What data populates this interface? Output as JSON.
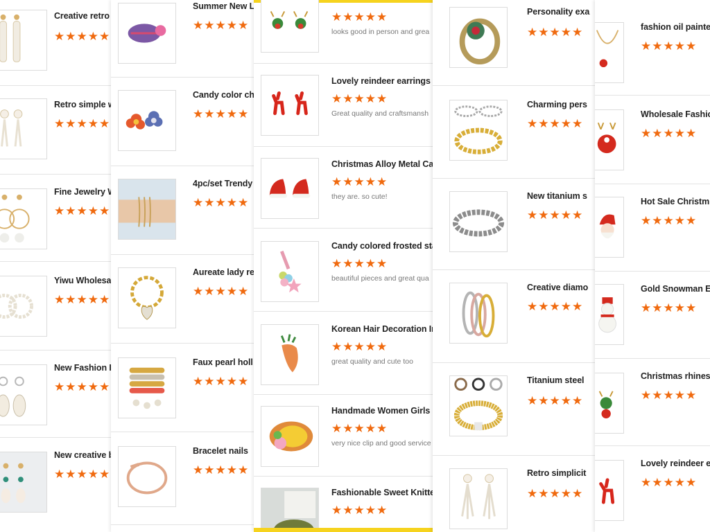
{
  "colors": {
    "star": "#f06a0f",
    "accent_bar": "#f6d31e",
    "border": "#dcdcdc"
  },
  "panels": [
    {
      "items": [
        {
          "title": "Creative retro",
          "stars": "★★★★★",
          "icon": "pearl-drop-earrings-icon"
        },
        {
          "title": "Retro simple w",
          "stars": "★★★★★",
          "icon": "pearl-tassel-earrings-icon"
        },
        {
          "title": "Fine Jewelry W",
          "stars": "★★★★★",
          "icon": "pearl-hoop-earrings-icon"
        },
        {
          "title": "Yiwu Wholesa",
          "stars": "★★★★★",
          "icon": "pearl-ring-earrings-icon"
        },
        {
          "title": "New Fashion E",
          "stars": "★★★★★",
          "icon": "shell-earrings-icon"
        },
        {
          "title": "New creative b",
          "stars": "★★★★★",
          "icon": "bead-drop-earrings-icon"
        }
      ]
    },
    {
      "items": [
        {
          "title": "Summer New L",
          "stars": "★★★★★",
          "icon": "knitted-hair-clip-icon"
        },
        {
          "title": "Candy color ch",
          "stars": "★★★★★",
          "icon": "flower-hair-clips-icon"
        },
        {
          "title": "4pc/set Trendy",
          "stars": "★★★★★",
          "icon": "bracelet-set-on-wrist-icon"
        },
        {
          "title": "Aureate lady re",
          "stars": "★★★★★",
          "icon": "gold-heart-chain-bracelet-icon"
        },
        {
          "title": "Faux pearl holl",
          "stars": "★★★★★",
          "icon": "bangle-stack-icon"
        },
        {
          "title": "Bracelet nails",
          "stars": "★★★★★",
          "icon": "nail-bangle-icon"
        }
      ]
    },
    {
      "items": [
        {
          "title": "",
          "stars": "★★★★★",
          "review": "looks good in person and grea",
          "icon": "reindeer-stud-earrings-icon"
        },
        {
          "title": "Lovely reindeer earrings fo",
          "stars": "★★★★★",
          "review": "Great quality and craftsmansh",
          "icon": "red-reindeer-earrings-icon"
        },
        {
          "title": "Christmas Alloy Metal Car",
          "stars": "★★★★★",
          "review": "they are. so cute!",
          "icon": "santa-hat-earrings-icon"
        },
        {
          "title": "Candy colored frosted star",
          "stars": "★★★★★",
          "review": "beautiful pieces and great qua",
          "icon": "star-hair-clip-icon"
        },
        {
          "title": "Korean Hair Decoration Im",
          "stars": "★★★★★",
          "review": "great quality and cute too",
          "icon": "carrot-hair-clip-icon"
        },
        {
          "title": "Handmade Women Girls S",
          "stars": "★★★★★",
          "review": "very nice clip and good service",
          "icon": "pineapple-hair-clip-icon"
        },
        {
          "title": "Fashionable Sweet Knitted",
          "stars": "★★★★★",
          "review": "",
          "icon": "knitted-headband-icon"
        }
      ]
    },
    {
      "items": [
        {
          "title": "Personality exa",
          "stars": "★★★★★",
          "icon": "jeweled-cuff-bracelet-icon"
        },
        {
          "title": "Charming pers",
          "stars": "★★★★★",
          "icon": "gold-silver-chain-bracelets-icon"
        },
        {
          "title": "New titanium s",
          "stars": "★★★★★",
          "icon": "silver-chain-bracelet-icon"
        },
        {
          "title": "Creative diamo",
          "stars": "★★★★★",
          "icon": "tri-color-bangles-icon"
        },
        {
          "title": "Titanium steel",
          "stars": "★★★★★",
          "icon": "mesh-bracelets-icon"
        },
        {
          "title": "Retro simplicit",
          "stars": "★★★★★",
          "icon": "pearl-tassel-earrings-icon"
        }
      ]
    },
    {
      "items": [
        {
          "title": "fashion oil painte",
          "stars": "★★★★★",
          "icon": "pendant-necklace-icon"
        },
        {
          "title": "Wholesale Fashio",
          "stars": "★★★★★",
          "icon": "reindeer-brooch-icon"
        },
        {
          "title": "Hot Sale Christm",
          "stars": "★★★★★",
          "icon": "santa-brooch-icon"
        },
        {
          "title": "Gold Snowman E",
          "stars": "★★★★★",
          "icon": "snowman-brooch-icon"
        },
        {
          "title": "Christmas rhines",
          "stars": "★★★★★",
          "icon": "reindeer-rhinestone-earring-icon"
        },
        {
          "title": "Lovely reindeer e",
          "stars": "★★★★★",
          "icon": "red-reindeer-earring-icon"
        }
      ]
    }
  ]
}
